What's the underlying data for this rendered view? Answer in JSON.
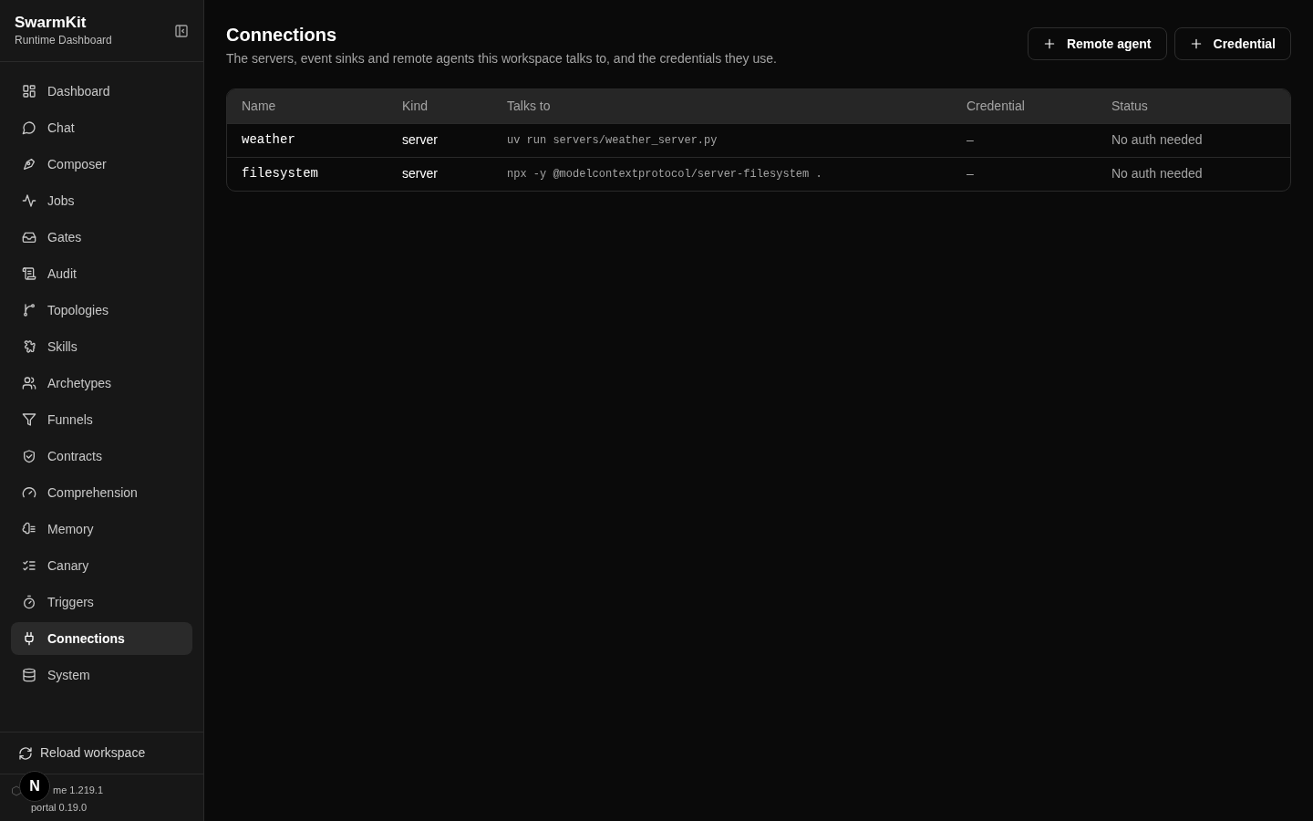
{
  "sidebar": {
    "title": "SwarmKit",
    "subtitle": "Runtime Dashboard",
    "items": [
      {
        "label": "Dashboard",
        "selected": false
      },
      {
        "label": "Chat",
        "selected": false
      },
      {
        "label": "Composer",
        "selected": false
      },
      {
        "label": "Jobs",
        "selected": false
      },
      {
        "label": "Gates",
        "selected": false
      },
      {
        "label": "Audit",
        "selected": false
      },
      {
        "label": "Topologies",
        "selected": false
      },
      {
        "label": "Skills",
        "selected": false
      },
      {
        "label": "Archetypes",
        "selected": false
      },
      {
        "label": "Funnels",
        "selected": false
      },
      {
        "label": "Contracts",
        "selected": false
      },
      {
        "label": "Comprehension",
        "selected": false
      },
      {
        "label": "Memory",
        "selected": false
      },
      {
        "label": "Canary",
        "selected": false
      },
      {
        "label": "Triggers",
        "selected": false
      },
      {
        "label": "Connections",
        "selected": true
      },
      {
        "label": "System",
        "selected": false
      }
    ],
    "reload": "Reload workspace",
    "versions": [
      "me 1.219.1",
      "portal 0.19.0"
    ],
    "badge": "N"
  },
  "page": {
    "title": "Connections",
    "description": "The servers, event sinks and remote agents this workspace talks to, and the credentials they use.",
    "buttons": [
      "Remote agent",
      "Credential"
    ]
  },
  "table": {
    "columns": [
      "Name",
      "Kind",
      "Talks to",
      "Credential",
      "Status"
    ],
    "rows": [
      [
        "weather",
        "server",
        "uv run servers/weather_server.py",
        "–",
        "No auth needed"
      ],
      [
        "filesystem",
        "server",
        "npx -y @modelcontextprotocol/server-filesystem .",
        "–",
        "No auth needed"
      ]
    ]
  }
}
